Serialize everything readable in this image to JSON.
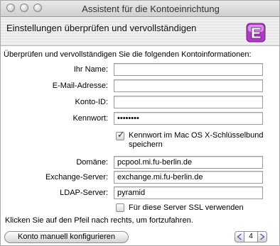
{
  "window": {
    "title": "Assistent für die Kontoeinrichtung"
  },
  "header": {
    "title": "Einstellungen überprüfen und vervollständigen",
    "logo_icon": "entourage-logo-icon"
  },
  "intro": "Überprüfen und vervollständigen Sie die folgenden Kontoinformationen:",
  "form": {
    "name_label": "Ihr Name:",
    "name_value": "",
    "email_label": "E-Mail-Adresse:",
    "email_value": "",
    "account_label": "Konto-ID:",
    "account_value": "",
    "password_label": "Kennwort:",
    "password_value": "••••••••",
    "keychain_label_line1": "Kennwort im Mac OS X-Schlüsselbund",
    "keychain_label_line2": "speichern",
    "keychain_checked": true,
    "domain_label": "Domäne:",
    "domain_value": "pcpool.mi.fu-berlin.de",
    "exchange_label": "Exchange-Server:",
    "exchange_value": "exchange.mi.fu-berlin.de",
    "ldap_label": "LDAP-Server:",
    "ldap_value": "pyramid",
    "ssl_label": "Für diese Server SSL verwenden",
    "ssl_checked": false
  },
  "hint": "Klicken Sie auf den Pfeil nach rechts, um fortzufahren.",
  "footer": {
    "manual_button": "Konto manuell konfigurieren",
    "page_number": "4"
  }
}
